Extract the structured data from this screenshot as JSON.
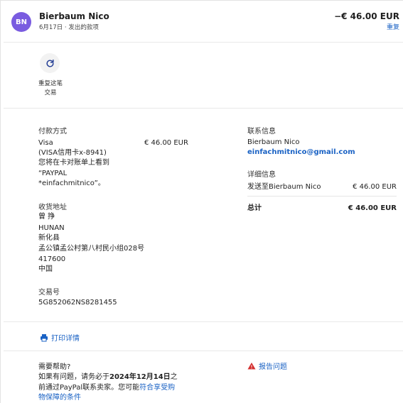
{
  "header": {
    "avatar_initials": "BN",
    "merchant": "Bierbaum Nico",
    "subline": "6月17日 · 发出的款项",
    "amount": "−€ 46.00 EUR",
    "repeat_link": "重复"
  },
  "repeat": {
    "icon": "refresh-icon",
    "label": "重复这笔交易"
  },
  "payment": {
    "title": "付款方式",
    "method": "Visa",
    "card": "(VISA信用卡x-8941)",
    "note_line1": "您将在卡对账单上看到",
    "note_line2": "“PAYPAL",
    "note_line3": "*einfachmitnico”。",
    "amount": "€ 46.00 EUR"
  },
  "shipping": {
    "title": "收货地址",
    "lines": [
      "曾 挣",
      "HUNAN",
      "新化县",
      "孟公镇孟公村第八村民小组028号",
      "417600",
      "中国"
    ]
  },
  "transaction": {
    "title": "交易号",
    "id": "5G852062NS8281455"
  },
  "contact": {
    "title": "联系信息",
    "name": "Bierbaum Nico",
    "email": "einfachmitnico@gmail.com"
  },
  "details": {
    "title": "详细信息",
    "line_label": "发送至Bierbaum Nico",
    "line_amount": "€ 46.00 EUR",
    "total_label": "总计",
    "total_amount": "€ 46.00 EUR"
  },
  "print": {
    "icon": "printer-icon",
    "label": "打印详情"
  },
  "help": {
    "title": "需要帮助?",
    "text_prefix": "如果有问题，请务必于",
    "date": "2024年12月14日",
    "text_suffix": "之",
    "line2_prefix": "前通过PayPal联系卖家。您可能",
    "link_part1": "符合享受购",
    "link_part2": "物保障的条件"
  },
  "report": {
    "icon": "warning-icon",
    "label": "报告问题"
  },
  "colors": {
    "accent": "#1a62c4",
    "avatar": "#7a5ce0",
    "warning": "#d32f2f"
  }
}
